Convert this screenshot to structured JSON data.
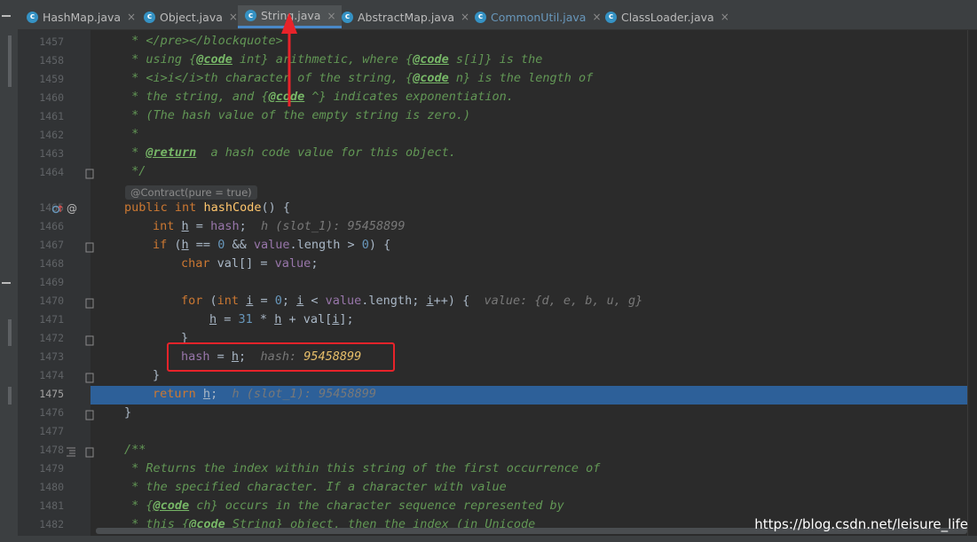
{
  "tabs": [
    {
      "label": "HashMap.java",
      "active": false,
      "color": "#bbbbbb"
    },
    {
      "label": "Object.java",
      "active": false,
      "color": "#bbbbbb"
    },
    {
      "label": "String.java",
      "active": true,
      "color": "#bbbbbb"
    },
    {
      "label": "AbstractMap.java",
      "active": false,
      "color": "#bbbbbb"
    },
    {
      "label": "CommonUtil.java",
      "active": false,
      "color": "#6897bb"
    },
    {
      "label": "ClassLoader.java",
      "active": false,
      "color": "#bbbbbb"
    }
  ],
  "tab_icon_letter": "c",
  "close_glyph": "×",
  "line_numbers": [
    "1457",
    "1458",
    "1459",
    "1460",
    "1461",
    "1462",
    "1463",
    "1464",
    "1465",
    "1466",
    "1467",
    "1468",
    "1469",
    "1470",
    "1471",
    "1472",
    "1473",
    "1474",
    "1475",
    "1476",
    "1477",
    "1478",
    "1479",
    "1480",
    "1481",
    "1482"
  ],
  "current_line": "1475",
  "contract_hint": "@Contract(pure = true)",
  "code": {
    "l1457": " * </pre></blockquote>",
    "l1458a": " * using {",
    "l1458b": "@code",
    "l1458c": " int} arithmetic, where {",
    "l1458d": "@code",
    "l1458e": " s[i]} is the",
    "l1459a": " * <i>i</i>th character of the string, {",
    "l1459b": "@code",
    "l1459c": " n} is the length of",
    "l1460a": " * the string, and {",
    "l1460b": "@code",
    "l1460c": " ^} indicates exponentiation.",
    "l1461": " * (The hash value of the empty string is zero.)",
    "l1462": " *",
    "l1463a": " * ",
    "l1463b": "@return",
    "l1463c": "  a hash code value for this object.",
    "l1464": " */",
    "l1465": {
      "kw1": "public",
      "kw2": "int",
      "fn": "hashCode",
      "rest": "() {"
    },
    "l1466": {
      "kw": "int",
      "v": "h",
      "eq": " = ",
      "f": "hash",
      "end": ";",
      "hint": "h (slot_1): 95458899"
    },
    "l1467": {
      "kw": "if",
      "a": " (",
      "v": "h",
      "b": " == ",
      "n": "0",
      "c": " && ",
      "f": "value",
      "d": ".length > ",
      "n2": "0",
      "e": ") {"
    },
    "l1468": {
      "kw": "char",
      "a": " val[] = ",
      "f": "value",
      "b": ";"
    },
    "l1470": {
      "kw": "for",
      "a": " (",
      "kw2": "int",
      "i1": "i",
      "b": " = ",
      "n": "0",
      "c": "; ",
      "i2": "i",
      "d": " < ",
      "f": "value",
      "e": ".length; ",
      "i3": "i",
      "g": "++) {",
      "hint": "value: {d, e, b, u, g}"
    },
    "l1471": {
      "v": "h",
      "a": " = ",
      "n": "31",
      "b": " * ",
      "v2": "h",
      "c": " + val[",
      "i": "i",
      "d": "];"
    },
    "l1472": "}",
    "l1473": {
      "f": "hash",
      "a": " = ",
      "v": "h",
      "b": ";",
      "hint_label": "hash:",
      "hint_val": "95458899"
    },
    "l1474": "}",
    "l1475": {
      "kw": "return",
      "v": "h",
      "a": ";",
      "hint": "h (slot_1): 95458899"
    },
    "l1476": "}",
    "l1478": "/**",
    "l1479": " * Returns the index within this string of the first occurrence of",
    "l1480": " * the specified character. If a character with value",
    "l1481a": " * {",
    "l1481b": "@code",
    "l1481c": " ch} occurs in the character sequence represented by",
    "l1482a": " * this {",
    "l1482b": "@code",
    "l1482c": " String} object, then the index (in Unicode"
  },
  "watermark": "https://blog.csdn.net/leisure_life",
  "annotation_color": "#e8232a"
}
